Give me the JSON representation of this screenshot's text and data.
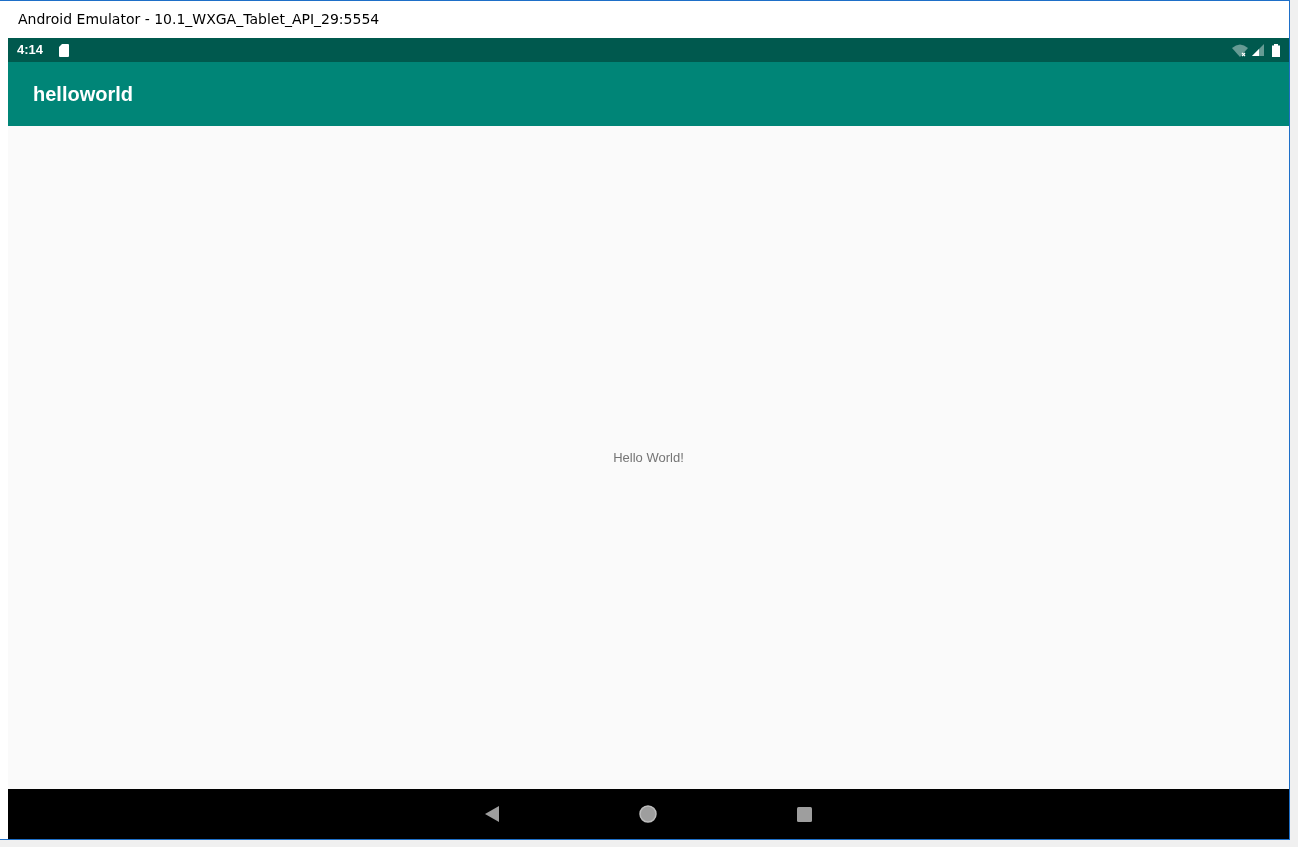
{
  "window": {
    "title": "Android Emulator - 10.1_WXGA_Tablet_API_29:5554"
  },
  "status_bar": {
    "time": "4:14"
  },
  "app_bar": {
    "title": "helloworld"
  },
  "content": {
    "text": "Hello World!"
  }
}
